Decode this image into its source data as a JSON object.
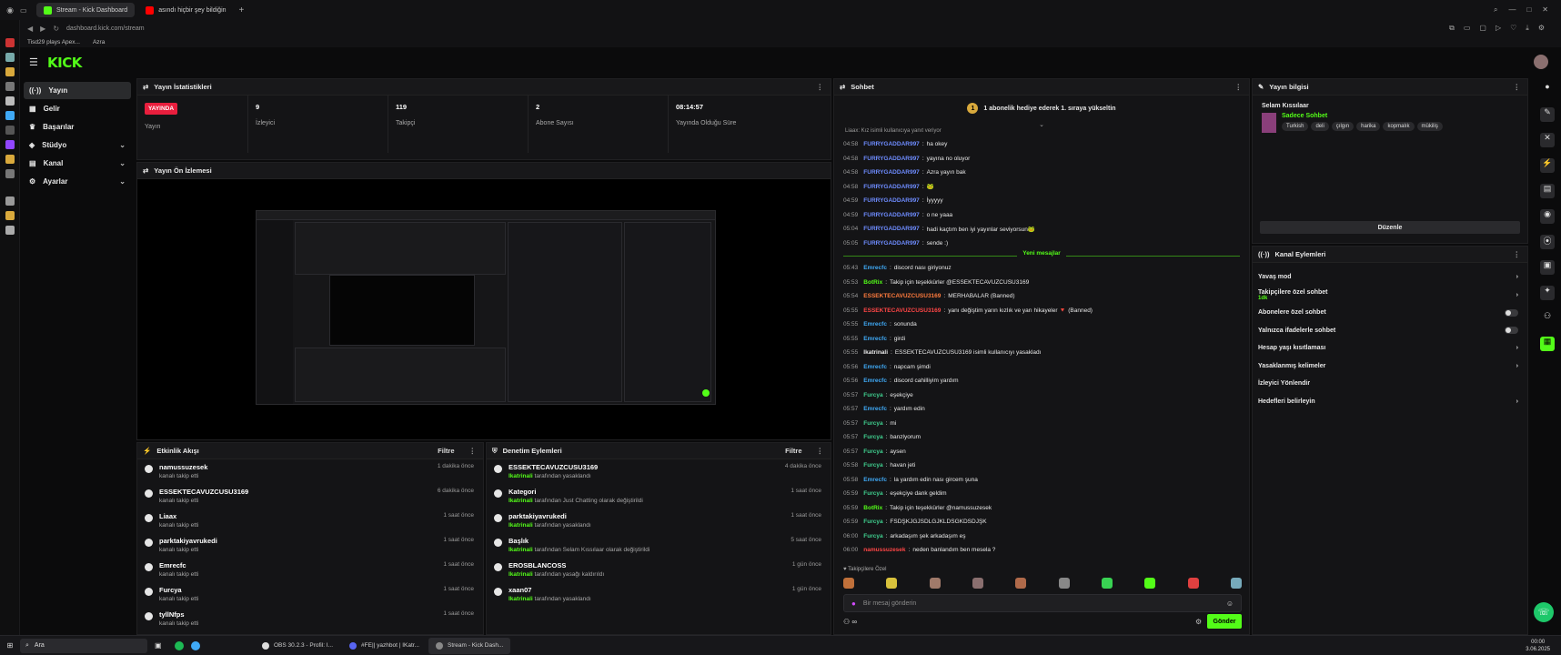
{
  "browser": {
    "tabs": [
      {
        "title": "Stream - Kick Dashboard",
        "active": true
      },
      {
        "title": "asındı hiçbir şey bildiğin",
        "active": false
      }
    ],
    "url": "dashboard.kick.com/stream",
    "bookmarks": [
      "Tisd29 plays Apex...",
      "Azra"
    ]
  },
  "brand": {
    "logo": "KICK",
    "accent": "#53fc18",
    "live_color": "#e91e3d"
  },
  "nav": {
    "items": [
      {
        "label": "Yayın",
        "active": true,
        "icon": "broadcast-icon"
      },
      {
        "label": "Gelir",
        "icon": "revenue-icon"
      },
      {
        "label": "Başarılar",
        "icon": "trophy-icon"
      },
      {
        "label": "Stüdyo",
        "icon": "studio-icon",
        "expandable": true
      },
      {
        "label": "Kanal",
        "icon": "channel-icon",
        "expandable": true
      },
      {
        "label": "Ayarlar",
        "icon": "gear-icon",
        "expandable": true
      }
    ]
  },
  "stats": {
    "title": "Yayın İstatistikleri",
    "items": [
      {
        "value": "YAYINDA",
        "label": "Yayın"
      },
      {
        "value": "9",
        "label": "İzleyici"
      },
      {
        "value": "119",
        "label": "Takipçi"
      },
      {
        "value": "2",
        "label": "Abone Sayısı"
      },
      {
        "value": "08:14:57",
        "label": "Yayında Olduğu Süre"
      }
    ]
  },
  "preview": {
    "title": "Yayın Ön İzlemesi"
  },
  "activity": {
    "title": "Etkinlik Akışı",
    "filter": "Filtre",
    "rows": [
      {
        "name": "namussuzesek",
        "sub": "kanalı takip etti",
        "time": "1 dakika önce"
      },
      {
        "name": "ESSEKTECAVUZCUSU3169",
        "sub": "kanalı takip etti",
        "time": "6 dakika önce"
      },
      {
        "name": "Liaax",
        "sub": "kanalı takip etti",
        "time": "1 saat önce"
      },
      {
        "name": "parktakiyavrukedi",
        "sub": "kanalı takip etti",
        "time": "1 saat önce"
      },
      {
        "name": "Emrecfc",
        "sub": "kanalı takip etti",
        "time": "1 saat önce"
      },
      {
        "name": "Furcya",
        "sub": "kanalı takip etti",
        "time": "1 saat önce"
      },
      {
        "name": "tyllNfps",
        "sub": "kanalı takip etti",
        "time": "1 saat önce"
      }
    ]
  },
  "moderation": {
    "title": "Denetim Eylemleri",
    "filter": "Filtre",
    "rows": [
      {
        "name": "ESSEKTECAVUZCUSU3169",
        "who": "Ikatrinali",
        "rest": "tarafından yasaklandı",
        "time": "4 dakika önce"
      },
      {
        "name": "Kategori",
        "who": "Ikatrinali",
        "rest": "tarafından Just Chatting olarak değiştirildi",
        "time": "1 saat önce"
      },
      {
        "name": "parktakiyavrukedi",
        "who": "Ikatrinali",
        "rest": "tarafından yasaklandı",
        "time": "1 saat önce"
      },
      {
        "name": "Başlık",
        "who": "Ikatrinali",
        "rest": "tarafından Selam Kıssılaar olarak değiştirildi",
        "time": "5 saat önce"
      },
      {
        "name": "EROSBLANCOSS",
        "who": "Ikatrinali",
        "rest": "tarafından yasağı kaldırıldı",
        "time": "1 gün önce"
      },
      {
        "name": "xaan07",
        "who": "Ikatrinali",
        "rest": "tarafından yasaklandı",
        "time": "1 gün önce"
      }
    ]
  },
  "chat": {
    "title": "Sohbet",
    "pinned": "1 abonelik hediye ederek 1. sıraya yükseltin",
    "reply_hint": "Liaax: Kız isimli kullanıcıya yanıt veriyor",
    "new_messages": "Yeni mesajlar",
    "messages": [
      {
        "time": "04:58",
        "user": "FURRYGADDAR997",
        "text": "ha okey",
        "color": "#6e8cff"
      },
      {
        "time": "04:58",
        "user": "FURRYGADDAR997",
        "text": "yayına no oluyor",
        "color": "#6e8cff"
      },
      {
        "time": "04:58",
        "user": "FURRYGADDAR997",
        "text": "Azra yayın bak",
        "color": "#6e8cff"
      },
      {
        "time": "04:58",
        "user": "FURRYGADDAR997",
        "text": "🐸",
        "color": "#6e8cff"
      },
      {
        "time": "04:59",
        "user": "FURRYGADDAR997",
        "text": "İyyyyy",
        "color": "#6e8cff"
      },
      {
        "time": "04:59",
        "user": "FURRYGADDAR997",
        "text": "o ne yaaa",
        "color": "#6e8cff"
      },
      {
        "time": "05:04",
        "user": "FURRYGADDAR997",
        "text": "hadi kaçtım ben iyi yayınlar seviyorsun🐸",
        "color": "#6e8cff"
      },
      {
        "time": "05:05",
        "user": "FURRYGADDAR997",
        "text": "sende :)",
        "color": "#6e8cff"
      }
    ],
    "messages_after": [
      {
        "time": "05:43",
        "user": "Emrecfc",
        "text": "discord nası giriyonuz",
        "color": "#3fa9f5"
      },
      {
        "time": "05:53",
        "user": "BotRix",
        "text": "Takip için teşekkürler @ESSEKTECAVUZCUSU3169",
        "color": "#53fc18"
      },
      {
        "time": "05:54",
        "user": "ESSEKTECAVUZCUSU3169",
        "text": "MERHABALAR (Banned)",
        "color": "#ff7b3d"
      },
      {
        "time": "05:55",
        "user": "ESSEKTECAVUZCUSU3169",
        "text": "yanı değiştim yarın kızlık ve yarı hikayeler 🔻 (Banned)",
        "color": "#ff4646"
      },
      {
        "time": "05:55",
        "user": "Emrecfc",
        "text": "sonunda",
        "color": "#3fa9f5"
      },
      {
        "time": "05:55",
        "user": "Emrecfc",
        "text": "girdi",
        "color": "#3fa9f5"
      },
      {
        "time": "05:55",
        "user": "Ikatrinali",
        "text": "ESSEKTECAVUZCUSU3169 isimli kullanıcıyı yasakladı",
        "color": "#e8e8e8"
      },
      {
        "time": "05:56",
        "user": "Emrecfc",
        "text": "napcam şimdi",
        "color": "#3fa9f5"
      },
      {
        "time": "05:56",
        "user": "Emrecfc",
        "text": "discord cahilliyim yardım",
        "color": "#3fa9f5"
      },
      {
        "time": "05:57",
        "user": "Furcya",
        "text": "eşekçiye",
        "color": "#3fd08f"
      },
      {
        "time": "05:57",
        "user": "Emrecfc",
        "text": "yardım edin",
        "color": "#3fa9f5"
      },
      {
        "time": "05:57",
        "user": "Furcya",
        "text": "mi",
        "color": "#3fd08f"
      },
      {
        "time": "05:57",
        "user": "Furcya",
        "text": "banzlyorum",
        "color": "#3fd08f"
      },
      {
        "time": "05:57",
        "user": "Furcya",
        "text": "aysen",
        "color": "#3fd08f"
      },
      {
        "time": "05:58",
        "user": "Furcya",
        "text": "havan jeti",
        "color": "#3fd08f"
      },
      {
        "time": "05:58",
        "user": "Emrecfc",
        "text": "la yardım edin nası gircem şuna",
        "color": "#3fa9f5"
      },
      {
        "time": "05:59",
        "user": "Furcya",
        "text": "eşekçiye dank geldim",
        "color": "#3fd08f"
      },
      {
        "time": "05:59",
        "user": "BotRix",
        "text": "Takip için teşekkürler @namussuzesek",
        "color": "#53fc18"
      },
      {
        "time": "05:59",
        "user": "Furcya",
        "text": "FSDŞKJGJSDLGJKLDSGKDSDJŞK",
        "color": "#3fd08f"
      },
      {
        "time": "06:00",
        "user": "Furcya",
        "text": "arkadaşım şek arkadaşım eş",
        "color": "#3fd08f"
      },
      {
        "time": "06:00",
        "user": "namussuzesek",
        "text": "neden banlandım ben mesela ?",
        "color": "#ff4646"
      }
    ],
    "emote_label": "Takipçilere Özel",
    "input_placeholder": "Bir mesaj gönderin",
    "send": "Gönder"
  },
  "stream_info": {
    "title": "Yayın bilgisi",
    "stream_title": "Selam Kıssılaar",
    "mode": "Sadece Sohbet",
    "tags": [
      "Turkish",
      "deli",
      "çılgın",
      "harika",
      "kopmalık",
      "mükiliş"
    ],
    "edit": "Düzenle"
  },
  "channel_actions": {
    "title": "Kanal Eylemleri",
    "items": [
      {
        "label": "Yavaş mod",
        "kind": "chevron"
      },
      {
        "label": "Takipçilere özel sohbet",
        "sub": "1dk",
        "kind": "chevron"
      },
      {
        "label": "Abonelere özel sohbet",
        "kind": "toggle"
      },
      {
        "label": "Yalnızca ifadelerle sohbet",
        "kind": "toggle"
      },
      {
        "label": "Hesap yaşı kısıtlaması",
        "kind": "chevron"
      },
      {
        "label": "Yasaklanmış kelimeler",
        "kind": "chevron"
      },
      {
        "label": "İzleyici Yönlendir",
        "kind": "none"
      },
      {
        "label": "Hedefleri belirleyin",
        "kind": "chevron"
      }
    ]
  },
  "taskbar": {
    "search": "Ara",
    "apps": [
      "OBS 30.2.3 - Profil: I...",
      "#FE|| yazhbot | IKatr...",
      "Stream - Kick Dash..."
    ],
    "clock": "00:00",
    "date": "3.06.2025"
  }
}
